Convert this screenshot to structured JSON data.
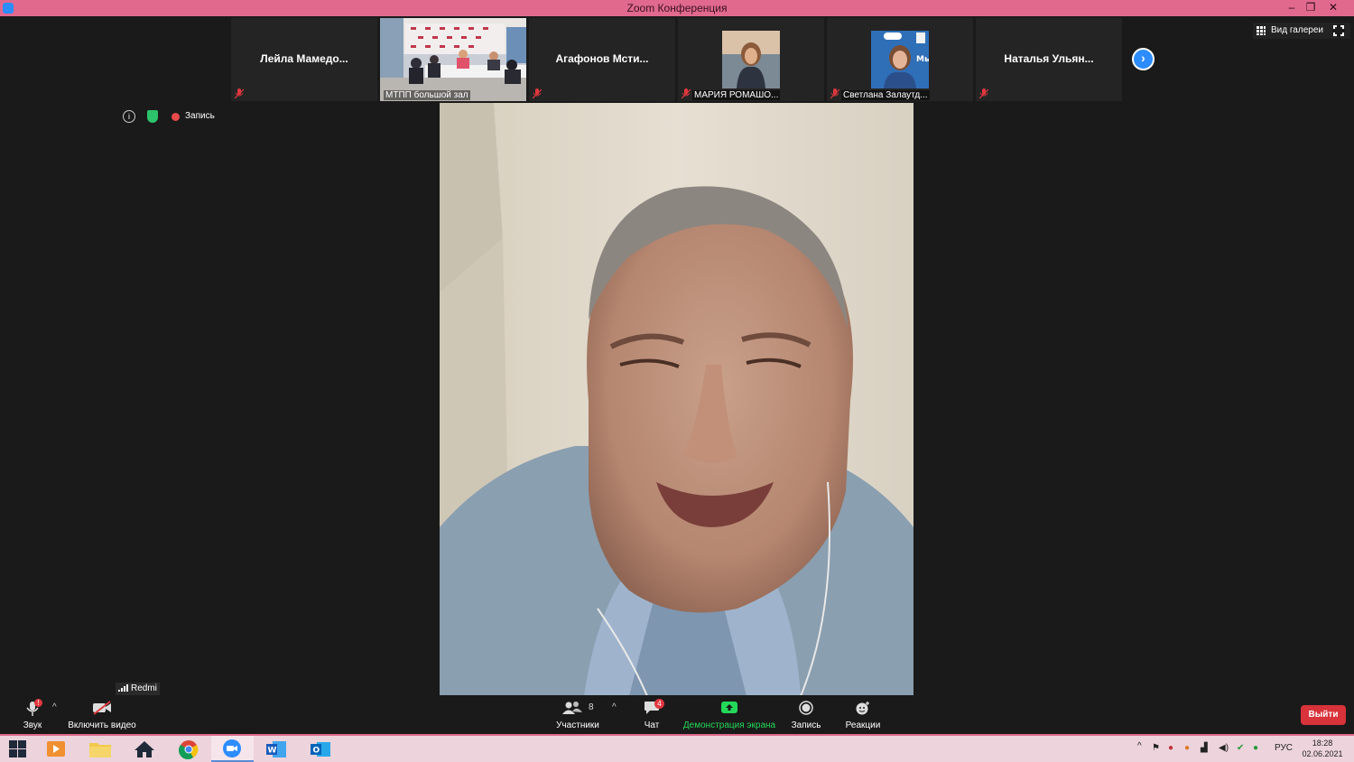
{
  "window": {
    "title": "Zoom Конференция"
  },
  "gallery": {
    "participants": [
      {
        "name": "Лейла  Мамедо...",
        "type": "name"
      },
      {
        "name": "МТПП большой зал",
        "type": "video"
      },
      {
        "name": "Агафонов  Мсти...",
        "type": "name"
      },
      {
        "name": "МАРИЯ РОМАШО...",
        "type": "photo"
      },
      {
        "name": "Светлана Залаутд...",
        "type": "photo"
      },
      {
        "name": "Наталья  Ульян...",
        "type": "name"
      }
    ],
    "view_label": "Вид галереи"
  },
  "meeting": {
    "recording_label": "Запись",
    "network_device": "Redmi"
  },
  "toolbar": {
    "audio_label": "Звук",
    "video_label": "Включить видео",
    "participants_label": "Участники",
    "participants_count": "8",
    "chat_label": "Чат",
    "chat_badge": "4",
    "share_label": "Демонстрация экрана",
    "record_label": "Запись",
    "reactions_label": "Реакции",
    "exit_label": "Выйти"
  },
  "taskbar": {
    "language": "РУС",
    "time": "18:28",
    "date": "02.06.2021"
  },
  "colors": {
    "accent": "#2d8cff",
    "share_green": "#23d959",
    "exit_red": "#d8323a",
    "window_frame": "#e0698d"
  }
}
